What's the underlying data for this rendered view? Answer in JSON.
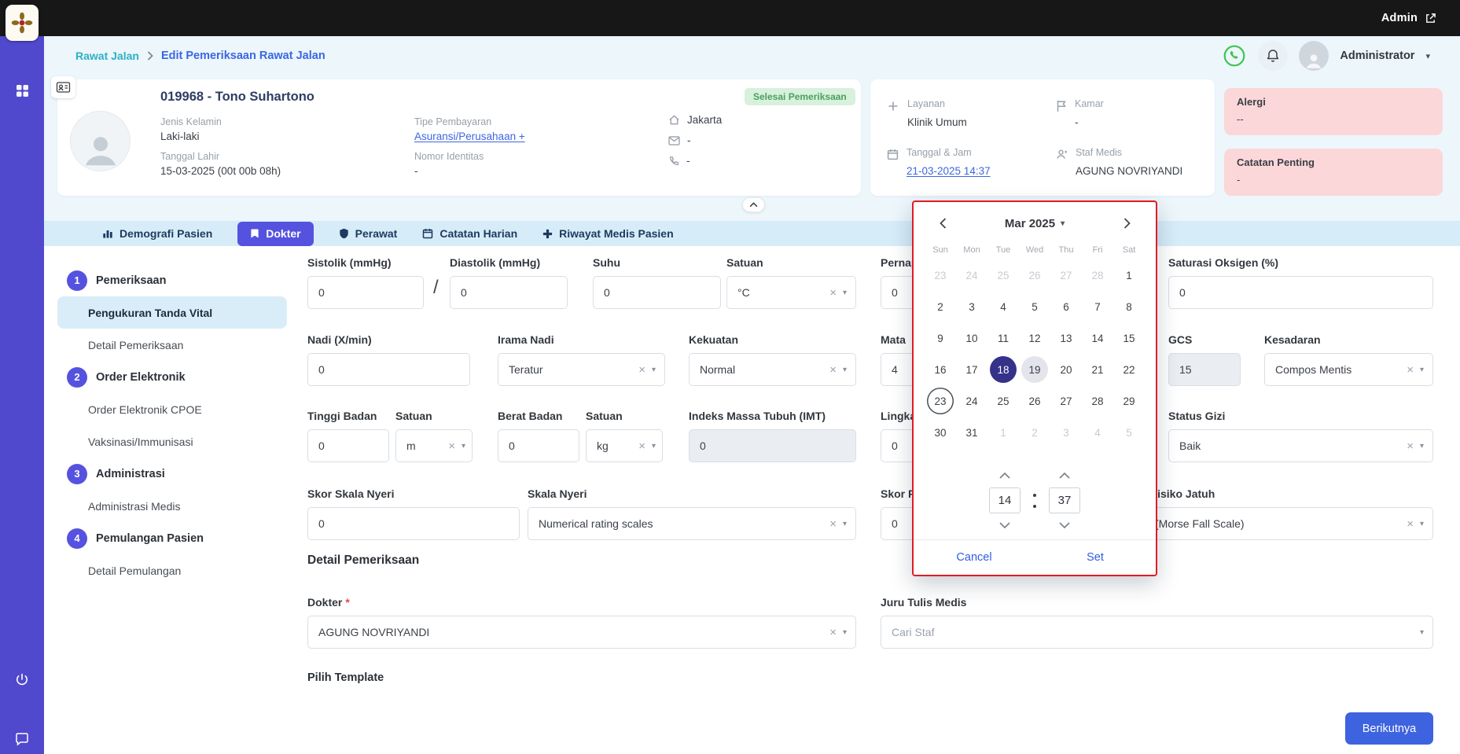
{
  "icons": {
    "clear": "×",
    "caret": "▾"
  },
  "sidebar_icons": [
    "apps-grid-icon",
    "power-icon",
    "chat-icon"
  ],
  "topbar": {
    "admin_label": "Admin"
  },
  "breadcrumb": {
    "items": [
      "Rawat Jalan",
      "Edit Pemeriksaan Rawat Jalan"
    ],
    "user_label": "Administrator"
  },
  "patient": {
    "name": "019968 - Tono Suhartono",
    "status_badge": "Selesai Pemeriksaan",
    "info": [
      {
        "label": "Jenis Kelamin",
        "value": "Laki-laki"
      },
      {
        "label": "Tanggal Lahir",
        "value": "15-03-2025 (00t 00b 08h)"
      },
      {
        "label": "Tipe Pembayaran",
        "value": "Asuransi/Perusahaan +"
      },
      {
        "label": "Nomor Identitas",
        "value": "-"
      }
    ],
    "contact": [
      {
        "icon": "home-icon",
        "value": "Jakarta"
      },
      {
        "icon": "mail-icon",
        "value": "-"
      },
      {
        "icon": "phone-icon",
        "value": "-"
      }
    ],
    "service": [
      {
        "icon": "medical-icon",
        "label": "Layanan",
        "value": "Klinik Umum"
      },
      {
        "icon": "flag-icon",
        "label": "Kamar",
        "value": "-"
      },
      {
        "icon": "calendar-icon",
        "label": "Tanggal & Jam",
        "value": "21-03-2025 14:37"
      },
      {
        "icon": "staff-icon",
        "label": "Staf Medis",
        "value": "AGUNG NOVRIYANDI"
      }
    ],
    "alerts": [
      {
        "label": "Alergi",
        "value": "--"
      },
      {
        "label": "Catatan Penting",
        "value": "-"
      }
    ]
  },
  "tabs": [
    {
      "label": "Demografi Pasien",
      "icon": "chart",
      "active": false
    },
    {
      "label": "Dokter",
      "icon": "doctor",
      "active": true
    },
    {
      "label": "Perawat",
      "icon": "shield",
      "active": false
    },
    {
      "label": "Catatan Harian",
      "icon": "calendar",
      "active": false
    },
    {
      "label": "Riwayat Medis Pasien",
      "icon": "medical-plus",
      "active": false
    }
  ],
  "nav": {
    "sections": [
      {
        "num": "1",
        "title": "Pemeriksaan",
        "items": [
          {
            "label": "Pengukuran Tanda Vital",
            "active": true
          },
          {
            "label": "Detail Pemeriksaan",
            "active": false
          }
        ]
      },
      {
        "num": "2",
        "title": "Order Elektronik",
        "items": [
          {
            "label": "Order Elektronik CPOE",
            "active": false
          },
          {
            "label": "Vaksinasi/Immunisasi",
            "active": false
          }
        ]
      },
      {
        "num": "3",
        "title": "Administrasi",
        "items": [
          {
            "label": "Administrasi Medis",
            "active": false
          }
        ]
      },
      {
        "num": "4",
        "title": "Pemulangan Pasien",
        "items": [
          {
            "label": "Detail Pemulangan",
            "active": false
          }
        ]
      }
    ]
  },
  "form": {
    "bp_separator": "/",
    "sistolik": {
      "label": "Sistolik (mmHg)",
      "value": "0"
    },
    "diastolik": {
      "label": "Diastolik (mmHg)",
      "value": "0"
    },
    "suhu": {
      "label": "Suhu",
      "value": "0"
    },
    "suhu_satuan": {
      "label": "Satuan",
      "value": "°C"
    },
    "pernapasan": {
      "label": "Pernapasan (X/min)",
      "value": "0"
    },
    "saturasi": {
      "label": "Saturasi Oksigen (%)",
      "value": "0"
    },
    "nadi": {
      "label": "Nadi (X/min)",
      "value": "0"
    },
    "irama_nadi": {
      "label": "Irama Nadi",
      "value": "Teratur"
    },
    "kekuatan": {
      "label": "Kekuatan",
      "value": "Normal"
    },
    "mata": {
      "label": "Mata",
      "value": "4"
    },
    "gcs": {
      "label": "GCS",
      "value": "15"
    },
    "kesadaran": {
      "label": "Kesadaran",
      "value": "Compos Mentis"
    },
    "tinggi": {
      "label": "Tinggi Badan",
      "value": "0"
    },
    "tinggi_satuan": {
      "label": "Satuan",
      "value": "m"
    },
    "berat": {
      "label": "Berat Badan",
      "value": "0"
    },
    "berat_satuan": {
      "label": "Satuan",
      "value": "kg"
    },
    "imt": {
      "label": "Indeks Massa Tubuh (IMT)",
      "value": "0"
    },
    "lingkar": {
      "label": "Lingkar Perut",
      "value": "0"
    },
    "status_gizi": {
      "label": "Status Gizi",
      "value": "Baik"
    },
    "skor_nyeri": {
      "label": "Skor Skala Nyeri",
      "value": "0"
    },
    "skala_nyeri": {
      "label": "Skala Nyeri",
      "value": "Numerical rating scales"
    },
    "skor_jatuh": {
      "label": "Skor Risiko Jatuh",
      "value": "0"
    },
    "risiko_jatuh": {
      "label": "Risiko Jatuh",
      "value": "(Morse Fall Scale)"
    },
    "section_heading": "Detail Pemeriksaan",
    "dokter": {
      "label": "Dokter",
      "required": "*",
      "value": "AGUNG NOVRIYANDI"
    },
    "juru": {
      "label": "Juru Tulis Medis",
      "placeholder": "Cari Staf"
    },
    "pilih_template_label": "Pilih Template",
    "next_button_label": "Berikutnya"
  },
  "datepicker": {
    "month_label": "Mar 2025",
    "weekdays": [
      "Sun",
      "Mon",
      "Tue",
      "Wed",
      "Thu",
      "Fri",
      "Sat"
    ],
    "weeks": [
      [
        {
          "d": "23",
          "s": "muted"
        },
        {
          "d": "24",
          "s": "muted"
        },
        {
          "d": "25",
          "s": "muted"
        },
        {
          "d": "26",
          "s": "muted"
        },
        {
          "d": "27",
          "s": "muted"
        },
        {
          "d": "28",
          "s": "muted"
        },
        {
          "d": "1"
        }
      ],
      [
        {
          "d": "2"
        },
        {
          "d": "3"
        },
        {
          "d": "4"
        },
        {
          "d": "5"
        },
        {
          "d": "6"
        },
        {
          "d": "7"
        },
        {
          "d": "8"
        }
      ],
      [
        {
          "d": "9"
        },
        {
          "d": "10"
        },
        {
          "d": "11"
        },
        {
          "d": "12"
        },
        {
          "d": "13"
        },
        {
          "d": "14"
        },
        {
          "d": "15"
        }
      ],
      [
        {
          "d": "16"
        },
        {
          "d": "17"
        },
        {
          "d": "18",
          "s": "selected"
        },
        {
          "d": "19",
          "s": "focus"
        },
        {
          "d": "20"
        },
        {
          "d": "21"
        },
        {
          "d": "22"
        }
      ],
      [
        {
          "d": "23",
          "s": "today"
        },
        {
          "d": "24"
        },
        {
          "d": "25"
        },
        {
          "d": "26"
        },
        {
          "d": "27"
        },
        {
          "d": "28"
        },
        {
          "d": "29"
        }
      ],
      [
        {
          "d": "30"
        },
        {
          "d": "31"
        },
        {
          "d": "1",
          "s": "muted"
        },
        {
          "d": "2",
          "s": "muted"
        },
        {
          "d": "3",
          "s": "muted"
        },
        {
          "d": "4",
          "s": "muted"
        },
        {
          "d": "5",
          "s": "muted"
        }
      ]
    ],
    "hour": "14",
    "minute": "37",
    "cancel_label": "Cancel",
    "set_label": "Set"
  }
}
